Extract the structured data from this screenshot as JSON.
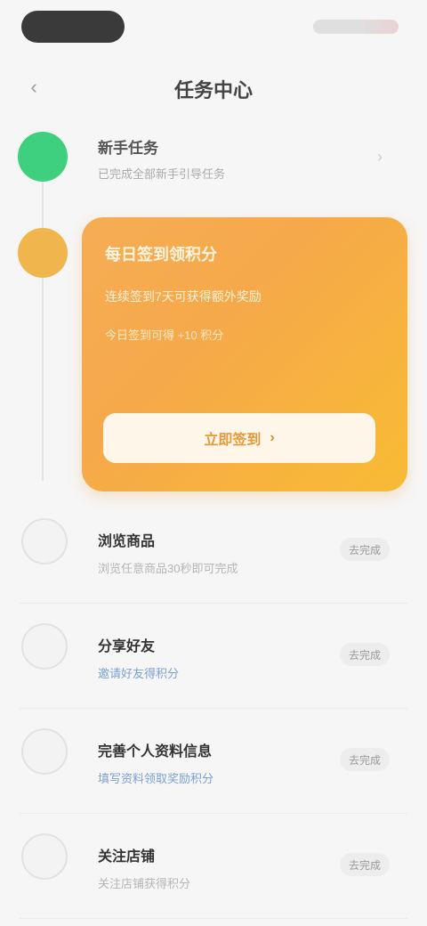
{
  "header": {
    "title": "任务中心",
    "back_icon": "chevron-left-icon"
  },
  "timeline": {
    "completed": {
      "title": "新手任务",
      "subtitle": "已完成全部新手引导任务",
      "chevron_icon": "chevron-right-icon"
    }
  },
  "card": {
    "title": "每日签到领积分",
    "line1": "连续签到7天可获得额外奖励",
    "line2": "今日签到可得 +10 积分",
    "button_label": "立即签到",
    "button_icon": "arrow-right-icon"
  },
  "list": {
    "items": [
      {
        "title": "浏览商品",
        "subtitle": "浏览任意商品30秒即可完成",
        "action": "去完成",
        "icon": "eye-icon"
      },
      {
        "title": "分享好友",
        "subtitle": "邀请好友得积分",
        "action": "去完成",
        "icon": "share-icon"
      },
      {
        "title": "完善个人资料信息",
        "subtitle": "填写资料领取奖励积分",
        "action": "去完成",
        "icon": "user-icon"
      },
      {
        "title": "关注店铺",
        "subtitle": "关注店铺获得积分",
        "action": "去完成",
        "icon": "store-icon"
      }
    ]
  },
  "colors": {
    "accent_green": "#3ecf7f",
    "accent_amber": "#f1b54e",
    "card_gradient_start": "#f5ad55",
    "card_gradient_end": "#f8bb34"
  }
}
